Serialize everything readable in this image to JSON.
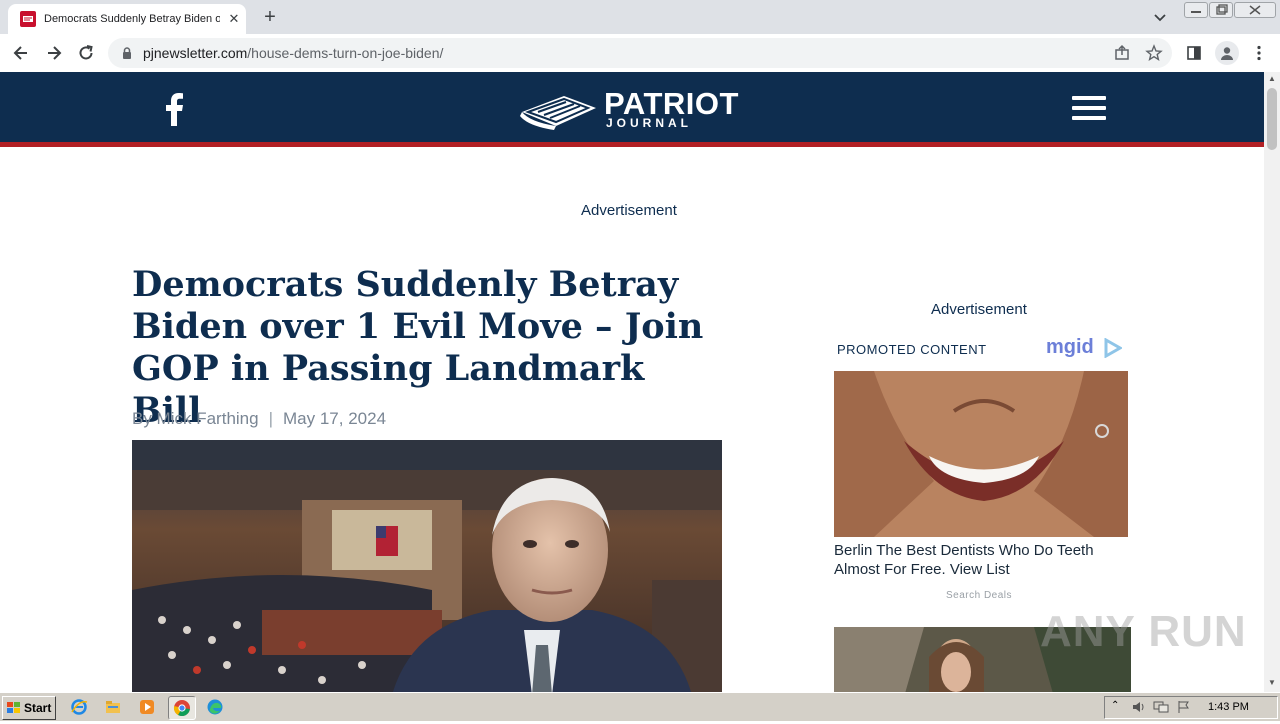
{
  "browser": {
    "tab_title": "Democrats Suddenly Betray Biden ov",
    "url_domain": "pjnewsletter.com",
    "url_path": "/house-dems-turn-on-joe-biden/"
  },
  "site": {
    "logo_word1": "PATRIOT",
    "logo_word2": "JOURNAL",
    "colors": {
      "header": "#0e2d4f",
      "accent": "#b21f24"
    }
  },
  "article": {
    "top_ad_label": "Advertisement",
    "headline": "Democrats Suddenly Betray Biden over 1 Evil Move – Join GOP in Passing Landmark Bill",
    "author": "By Mick Farthing",
    "byline_separator": "|",
    "date": "May 17, 2024"
  },
  "sidebar": {
    "ad_label": "Advertisement",
    "promoted_header": "PROMOTED CONTENT",
    "brand": "mgid",
    "promo_caption": "Berlin The Best Dentists Who Do Teeth Almost For Free. View List",
    "promo_source": "Search Deals"
  },
  "watermark": "ANY RUN",
  "taskbar": {
    "start_label": "Start",
    "clock": "1:43 PM"
  }
}
